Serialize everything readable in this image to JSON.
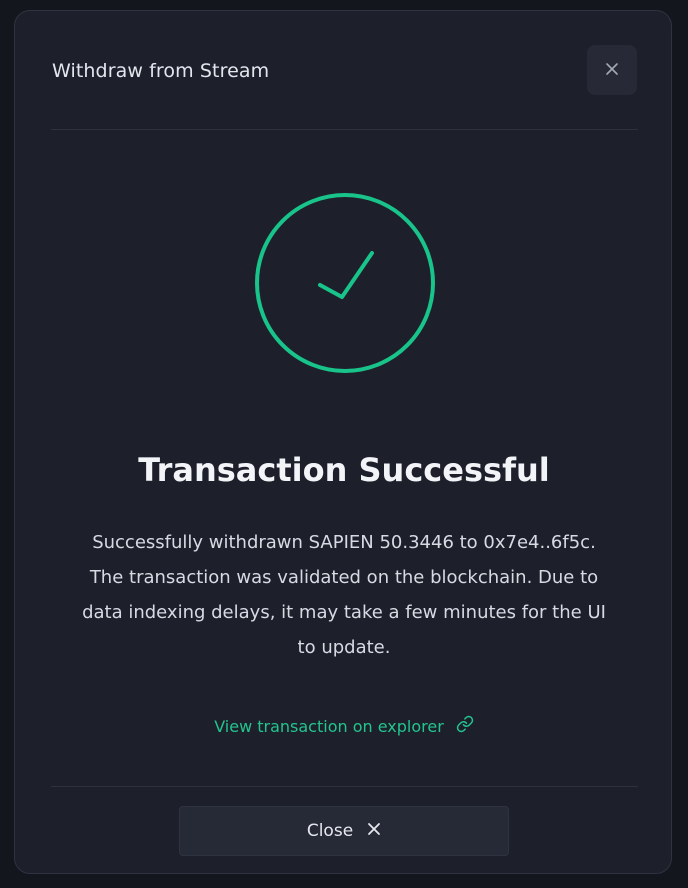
{
  "modal": {
    "title": "Withdraw from Stream",
    "close_icon": "close-icon"
  },
  "status": {
    "icon": "checkmark-circle-icon",
    "accent_color": "#19c48b",
    "heading": "Transaction Successful",
    "message": "Successfully withdrawn SAPIEN 50.3446 to 0x7e4..6f5c. The transaction was validated on the blockchain. Due to data indexing delays, it may take a few minutes for the UI to update."
  },
  "explorer_link": {
    "label": "View transaction on explorer",
    "icon": "link-icon"
  },
  "footer": {
    "close_label": "Close",
    "close_icon": "close-icon"
  }
}
